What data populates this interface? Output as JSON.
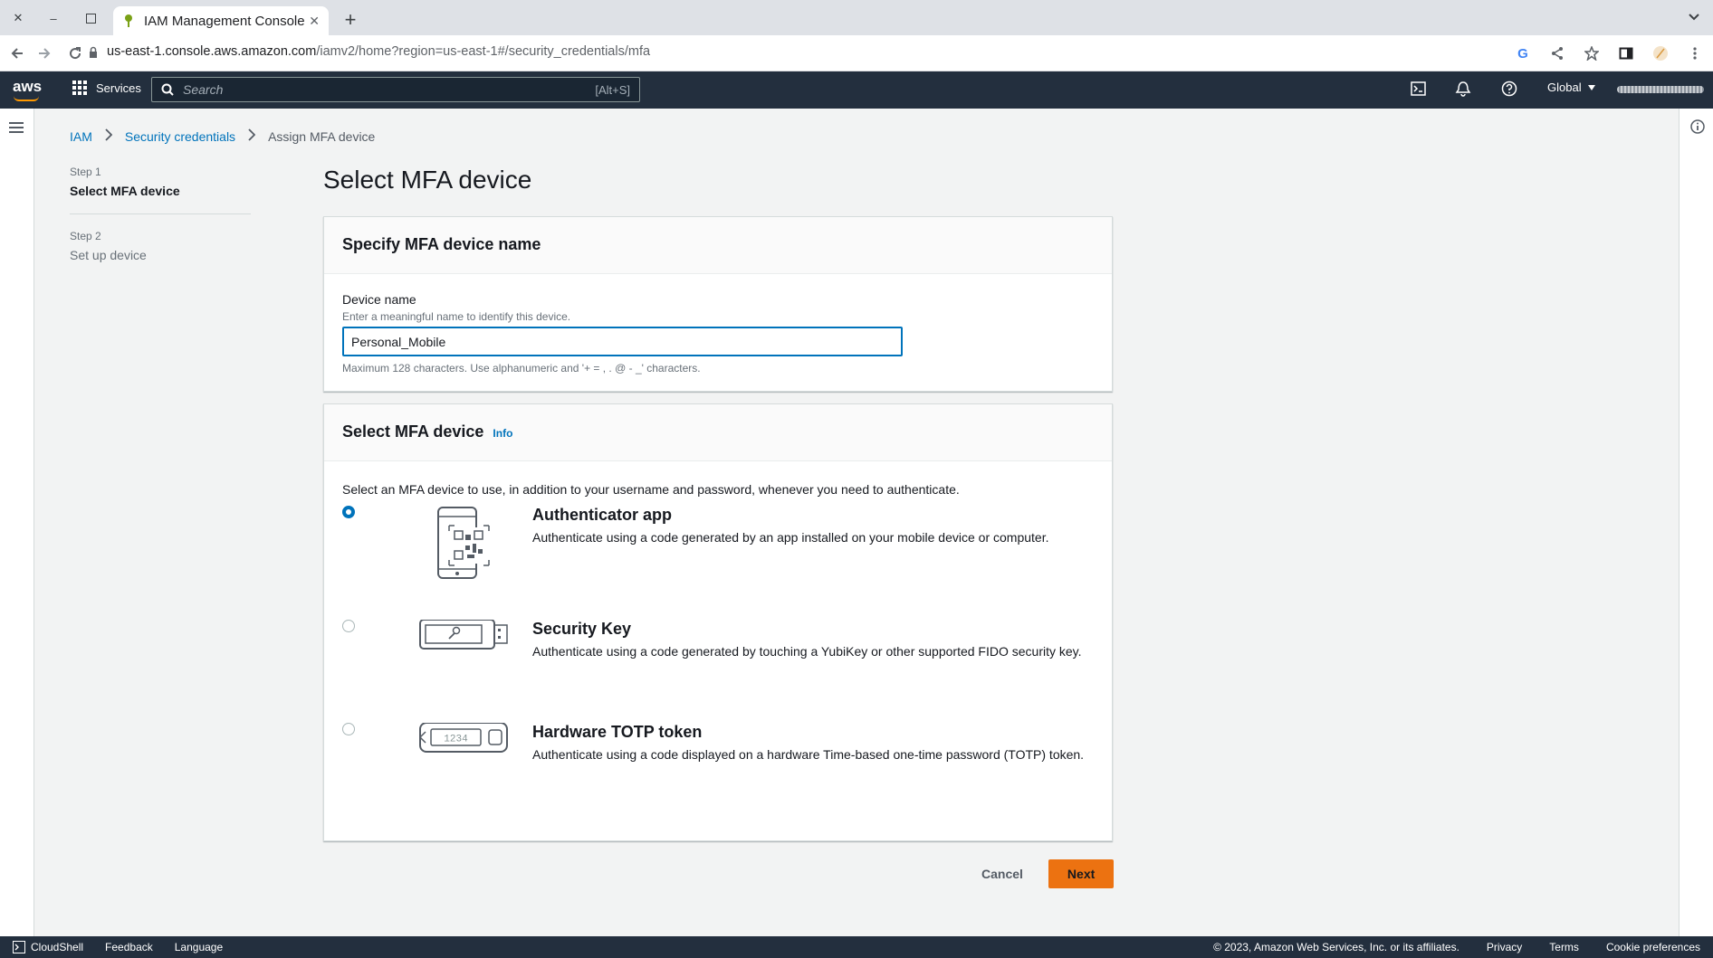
{
  "browser": {
    "tab_title": "IAM Management Console",
    "url_host": "us-east-1.console.aws.amazon.com",
    "url_path": "/iamv2/home?region=us-east-1#/security_credentials/mfa"
  },
  "aws_nav": {
    "logo": "aws",
    "services_label": "Services",
    "search_placeholder": "Search",
    "search_shortcut": "[Alt+S]",
    "region_label": "Global"
  },
  "breadcrumb": {
    "items": [
      "IAM",
      "Security credentials"
    ],
    "current": "Assign MFA device"
  },
  "wizard": {
    "steps": [
      {
        "label": "Step 1",
        "title": "Select MFA device",
        "active": true
      },
      {
        "label": "Step 2",
        "title": "Set up device",
        "active": false
      }
    ]
  },
  "page_title": "Select MFA device",
  "name_section": {
    "heading": "Specify MFA device name",
    "label": "Device name",
    "description": "Enter a meaningful name to identify this device.",
    "value": "Personal_Mobile",
    "constraint": "Maximum 128 characters. Use alphanumeric and '+ = , . @ - _' characters."
  },
  "device_section": {
    "heading": "Select MFA device",
    "info_link": "Info",
    "intro": "Select an MFA device to use, in addition to your username and password, whenever you need to authenticate.",
    "options": [
      {
        "title": "Authenticator app",
        "description": "Authenticate using a code generated by an app installed on your mobile device or computer.",
        "selected": true,
        "icon": "phone-qr-icon"
      },
      {
        "title": "Security Key",
        "description": "Authenticate using a code generated by touching a YubiKey or other supported FIDO security key.",
        "selected": false,
        "icon": "security-key-icon"
      },
      {
        "title": "Hardware TOTP token",
        "description": "Authenticate using a code displayed on a hardware Time-based one-time password (TOTP) token.",
        "selected": false,
        "icon": "totp-token-icon",
        "token_display": "1234"
      }
    ]
  },
  "actions": {
    "cancel": "Cancel",
    "next": "Next"
  },
  "footer": {
    "cloudshell": "CloudShell",
    "feedback": "Feedback",
    "language": "Language",
    "copyright": "© 2023, Amazon Web Services, Inc. or its affiliates.",
    "privacy": "Privacy",
    "terms": "Terms",
    "cookies": "Cookie preferences"
  },
  "colors": {
    "aws_nav_bg": "#232f3e",
    "link_blue": "#0073bb",
    "primary_orange": "#ec7211"
  }
}
